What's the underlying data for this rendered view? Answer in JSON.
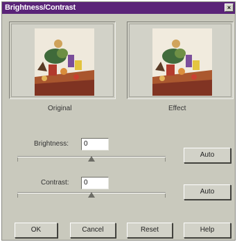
{
  "window": {
    "title": "Brightness/Contrast",
    "close_glyph": "×"
  },
  "previews": {
    "original_label": "Original",
    "effect_label": "Effect"
  },
  "brightness": {
    "label": "Brightness:",
    "value": "0",
    "auto_label": "Auto",
    "slider_level": 0.5
  },
  "contrast": {
    "label": "Contrast:",
    "value": "0",
    "auto_label": "Auto",
    "slider_level": 0.5
  },
  "buttons": {
    "ok": "OK",
    "cancel": "Cancel",
    "reset": "Reset",
    "help": "Help"
  },
  "colors": {
    "titlebar": "#5a2378",
    "dialog_bg": "#c9c9bd"
  }
}
